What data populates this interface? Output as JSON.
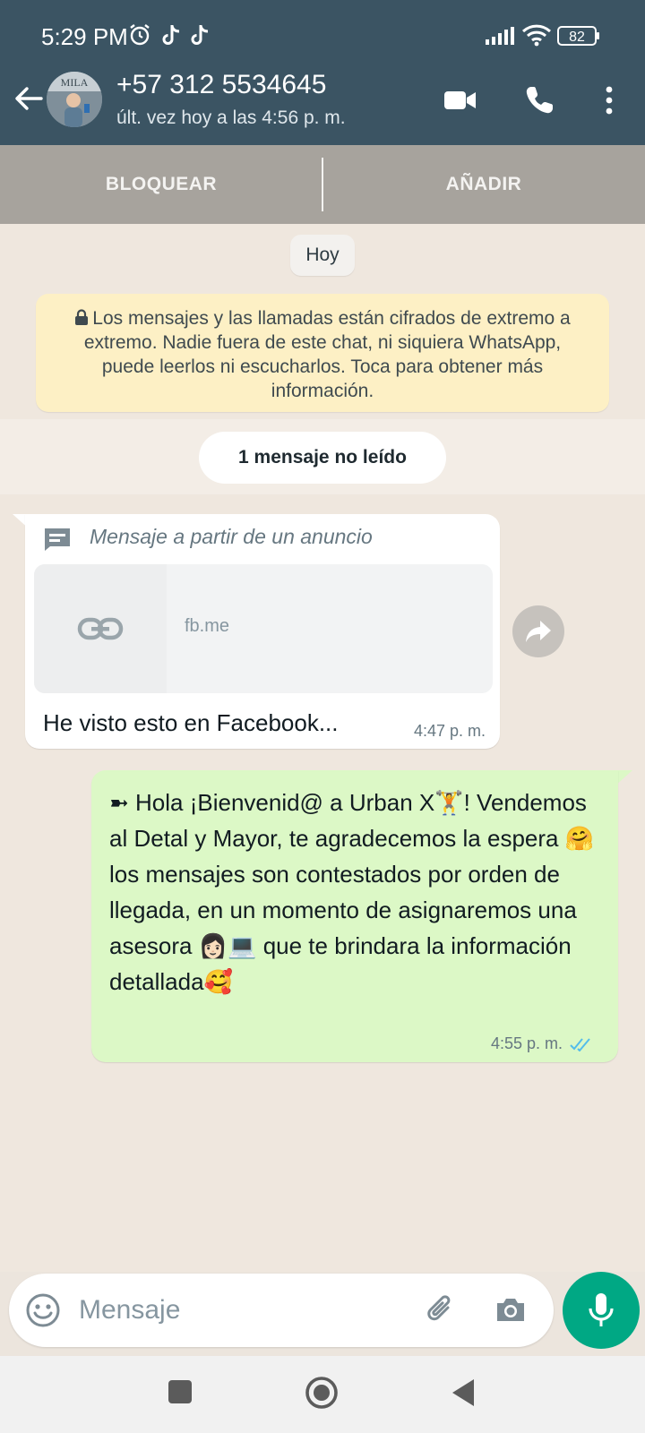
{
  "status_bar": {
    "time": "5:29 PM",
    "battery": "82",
    "icons": [
      "alarm-icon",
      "tiktok-icon",
      "tiktok-icon",
      "signal-icon",
      "wifi-icon",
      "battery-icon"
    ]
  },
  "header": {
    "contact_name": "+57 312 5534645",
    "last_seen": "últ. vez hoy a las 4:56 p. m.",
    "icons": [
      "back-arrow-icon",
      "video-call-icon",
      "phone-icon",
      "more-vert-icon"
    ],
    "color": "#3b5463"
  },
  "actions": {
    "block_label": "BLOQUEAR",
    "add_label": "AÑADIR"
  },
  "chat": {
    "date_label": "Hoy",
    "encryption_notice": "Los mensajes y las llamadas están cifrados de extremo a extremo. Nadie fuera de este chat, ni siquiera WhatsApp, puede leerlos ni escucharlos. Toca para obtener más información.",
    "unread_label": "1 mensaje no leído",
    "incoming": {
      "ad_label": "Mensaje a partir de un anuncio",
      "link_domain": "fb.me",
      "text": "He visto esto en Facebook...",
      "time": "4:47 p. m."
    },
    "outgoing": {
      "text": "➼ Hola ¡Bienvenid@ a Urban X🏋️! Vendemos al Detal y Mayor, te agradecemos la espera 🤗 los mensajes son contestados por orden de llegada, en un momento de asignaremos una asesora 👩🏻💻 que te brindara la información detallada🥰",
      "time": "4:55 p. m.",
      "status": "read"
    }
  },
  "composer": {
    "placeholder": "Mensaje",
    "accent": "#00a884"
  },
  "nav": {
    "icons": [
      "recents-icon",
      "home-icon",
      "back-icon"
    ]
  }
}
